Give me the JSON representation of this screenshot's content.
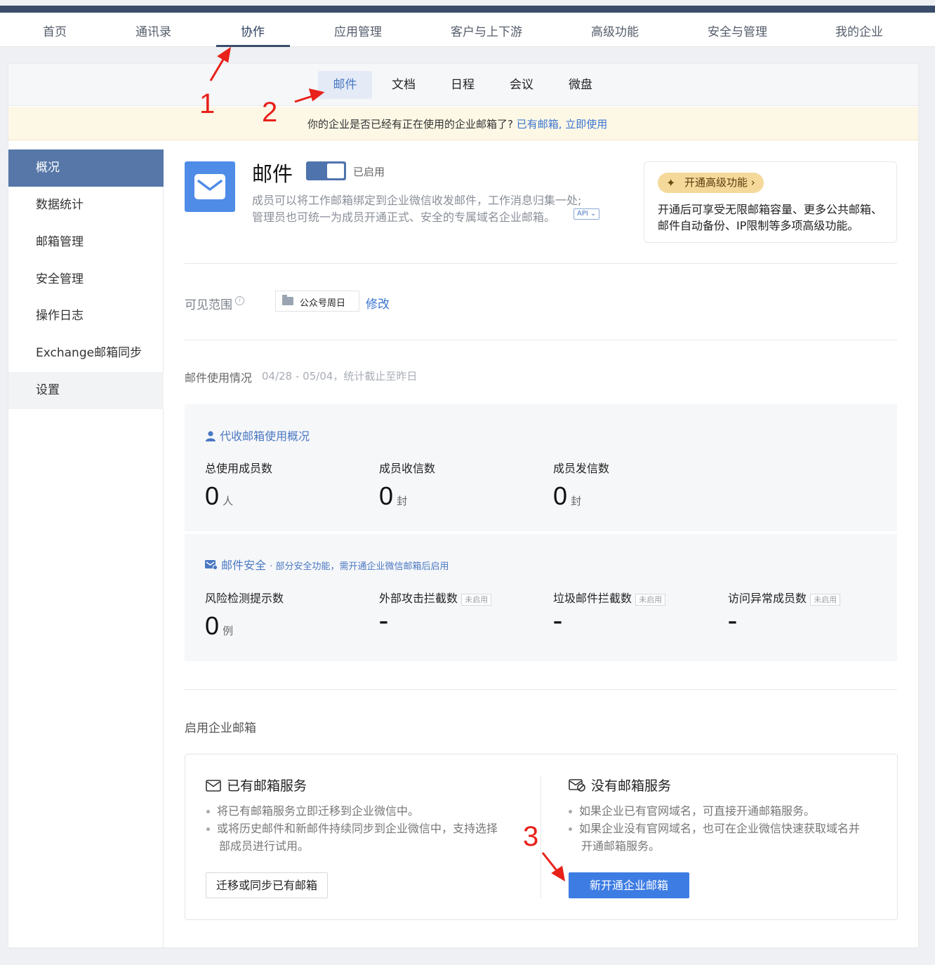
{
  "topnav": {
    "items": [
      "首页",
      "通讯录",
      "协作",
      "应用管理",
      "客户与上下游",
      "高级功能",
      "安全与管理",
      "我的企业"
    ]
  },
  "subnav": {
    "tabs": [
      "邮件",
      "文档",
      "日程",
      "会议",
      "微盘"
    ]
  },
  "banner": {
    "text": "你的企业是否已经有正在使用的企业邮箱了?",
    "link": "已有邮箱, 立即使用"
  },
  "sidebar": {
    "items": [
      "概况",
      "数据统计",
      "邮箱管理",
      "安全管理",
      "操作日志",
      "Exchange邮箱同步",
      "设置"
    ]
  },
  "app": {
    "title": "邮件",
    "status": "已启用",
    "desc_line1": "成员可以将工作邮箱绑定到企业微信收发邮件，工作消息归集一处;",
    "desc_line2": "管理员也可统一为成员开通正式、安全的专属域名企业邮箱。",
    "api_badge": "API ⌄"
  },
  "promo": {
    "button": "开通高级功能",
    "text": "开通后可享受无限邮箱容量、更多公共邮箱、邮件自动备份、IP限制等多项高级功能。"
  },
  "scope": {
    "label": "可见范围",
    "info": "i",
    "chip": "公众号周日",
    "edit": "修改"
  },
  "usage": {
    "title": "邮件使用情况",
    "date": "04/28 - 05/04，统计截止至昨日"
  },
  "proxy": {
    "title": "代收邮箱使用概况",
    "stats": [
      {
        "label": "总使用成员数",
        "value": "0",
        "unit": "人"
      },
      {
        "label": "成员收信数",
        "value": "0",
        "unit": "封"
      },
      {
        "label": "成员发信数",
        "value": "0",
        "unit": "封"
      }
    ]
  },
  "security": {
    "title": "邮件安全",
    "subtitle": "· 部分安全功能，需开通企业微信邮箱后启用",
    "stats": [
      {
        "label": "风险检测提示数",
        "value": "0",
        "unit": "例",
        "tag": ""
      },
      {
        "label": "外部攻击拦截数",
        "value": "–",
        "unit": "",
        "tag": "未启用"
      },
      {
        "label": "垃圾邮件拦截数",
        "value": "–",
        "unit": "",
        "tag": "未启用"
      },
      {
        "label": "访问异常成员数",
        "value": "–",
        "unit": "",
        "tag": "未启用"
      }
    ]
  },
  "enable": {
    "title": "启用企业邮箱",
    "existing": {
      "title": "已有邮箱服务",
      "items": [
        "将已有邮箱服务立即迁移到企业微信中。",
        "或将历史邮件和新邮件持续同步到企业微信中，支持选择",
        "部成员进行试用。"
      ],
      "button": "迁移或同步已有邮箱"
    },
    "new": {
      "title": "没有邮箱服务",
      "items": [
        "如果企业已有官网域名，可直接开通邮箱服务。",
        "如果企业没有官网域名，也可在企业微信快速获取域名并",
        "开通邮箱服务。"
      ],
      "button": "新开通企业邮箱"
    }
  },
  "annotations": [
    "1",
    "2",
    "3"
  ],
  "colors": {
    "accent": "#4a78c2",
    "sidebar_active": "#5677a8",
    "primary_button": "#3d7ce3",
    "annotation": "#e8211a",
    "promo": "#f4d99b"
  }
}
